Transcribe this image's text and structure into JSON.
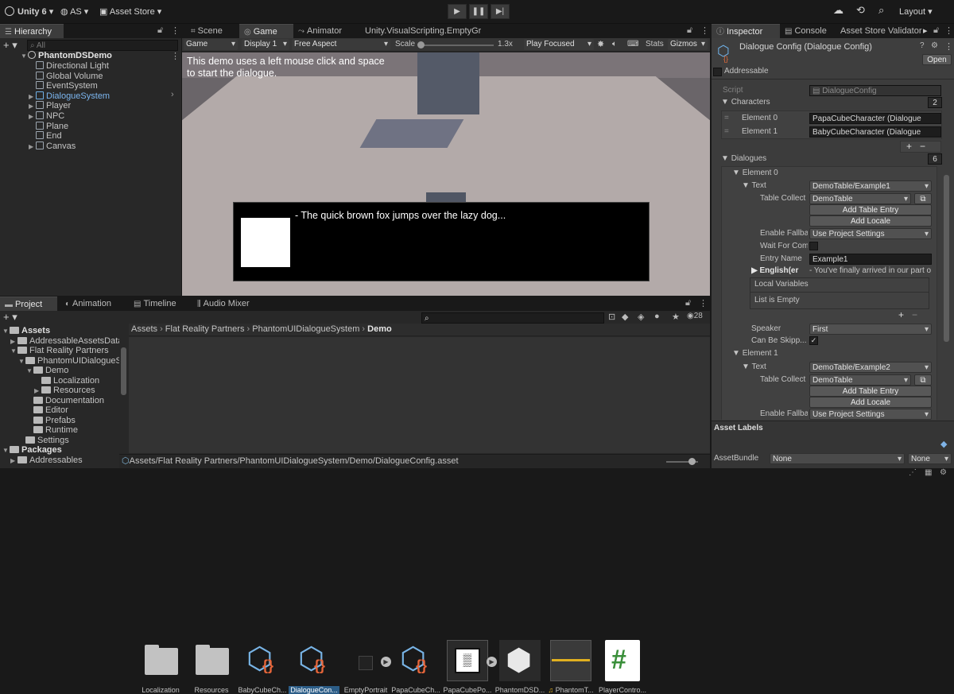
{
  "topbar": {
    "app": "Unity 6",
    "account": "AS",
    "store": "Asset Store",
    "layout": "Layout"
  },
  "hierarchy": {
    "tab": "Hierarchy",
    "search_placeholder": "All",
    "scene": "PhantomDSDemo",
    "items": [
      "Directional Light",
      "Global Volume",
      "EventSystem",
      "DialogueSystem",
      "Player",
      "NPC",
      "Plane",
      "End",
      "Canvas"
    ]
  },
  "center_tabs": [
    "Scene",
    "Game",
    "Animator",
    "Unity.VisualScripting.EmptyGraph"
  ],
  "game_toolbar": {
    "game": "Game",
    "display": "Display 1",
    "aspect": "Free Aspect",
    "scale_label": "Scale",
    "scale_value": "1.3x",
    "play_mode": "Play Focused",
    "stats": "Stats",
    "gizmos": "Gizmos"
  },
  "game_view": {
    "hint_line1": "This demo uses a left mouse click and space",
    "hint_line2": "to start the dialogue.",
    "dialogue_text": "- The quick brown fox jumps over the lazy dog..."
  },
  "bottom_tabs": [
    "Project",
    "Animation",
    "Timeline",
    "Audio Mixer"
  ],
  "project": {
    "count": "28",
    "tree": [
      {
        "label": "Assets",
        "indent": 0,
        "bold": true,
        "fold": "open"
      },
      {
        "label": "AddressableAssetsData",
        "indent": 1,
        "fold": "closed"
      },
      {
        "label": "Flat Reality Partners",
        "indent": 1,
        "fold": "open"
      },
      {
        "label": "PhantomUIDialogueSys",
        "indent": 2,
        "fold": "open"
      },
      {
        "label": "Demo",
        "indent": 3,
        "fold": "open"
      },
      {
        "label": "Localization",
        "indent": 4,
        "fold": ""
      },
      {
        "label": "Resources",
        "indent": 4,
        "fold": "closed"
      },
      {
        "label": "Documentation",
        "indent": 3,
        "fold": ""
      },
      {
        "label": "Editor",
        "indent": 3,
        "fold": ""
      },
      {
        "label": "Prefabs",
        "indent": 3,
        "fold": ""
      },
      {
        "label": "Runtime",
        "indent": 3,
        "fold": ""
      },
      {
        "label": "Settings",
        "indent": 2,
        "fold": ""
      },
      {
        "label": "Packages",
        "indent": 0,
        "bold": true,
        "fold": "open"
      },
      {
        "label": "Addressables",
        "indent": 1,
        "fold": "closed"
      }
    ],
    "breadcrumb": [
      "Assets",
      "Flat Reality Partners",
      "PhantomUIDialogueSystem",
      "Demo"
    ],
    "assets": [
      "Localization",
      "Resources",
      "BabyCubeCh...",
      "DialogueCon...",
      "EmptyPortrait",
      "PapaCubeCh...",
      "PapaCubePo...",
      "PhantomDSD...",
      "PhantomT...",
      "PlayerContro..."
    ],
    "status_path": "Assets/Flat Reality Partners/PhantomUIDialogueSystem/Demo/DialogueConfig.asset"
  },
  "right_tabs": [
    "Inspector",
    "Console",
    "Asset Store Validator"
  ],
  "inspector": {
    "title": "Dialogue Config (Dialogue Config)",
    "open": "Open",
    "addressable": "Addressable",
    "script_label": "Script",
    "script_value": "DialogueConfig",
    "characters_label": "Characters",
    "characters_count": "2",
    "characters": [
      {
        "label": "Element 0",
        "value": "PapaCubeCharacter (Dialogue"
      },
      {
        "label": "Element 1",
        "value": "BabyCubeCharacter (Dialogue"
      }
    ],
    "dialogues_label": "Dialogues",
    "dialogues_count": "6",
    "el0": {
      "label": "Element 0",
      "text_label": "Text",
      "text_value": "DemoTable/Example1",
      "table_label": "Table Collect",
      "table_value": "DemoTable",
      "add_entry": "Add Table Entry",
      "add_locale": "Add Locale",
      "fallback_label": "Enable Fallba",
      "fallback_value": "Use Project Settings",
      "wait_label": "Wait For Com",
      "entry_label": "Entry Name",
      "entry_value": "Example1",
      "english_label": "English(er",
      "english_value": "- You've finally arrived in our part o",
      "local_vars": "Local Variables",
      "list_empty": "List is Empty",
      "speaker_label": "Speaker",
      "speaker_value": "First",
      "skip_label": "Can Be Skipp..."
    },
    "el1": {
      "label": "Element 1",
      "text_label": "Text",
      "text_value": "DemoTable/Example2",
      "table_label": "Table Collect",
      "table_value": "DemoTable",
      "add_entry": "Add Table Entry",
      "add_locale": "Add Locale",
      "fallback_label": "Enable Fallba",
      "fallback_value": "Use Project Settings"
    },
    "asset_labels": "Asset Labels",
    "assetbundle_label": "AssetBundle",
    "assetbundle_value": "None",
    "variant_value": "None"
  }
}
